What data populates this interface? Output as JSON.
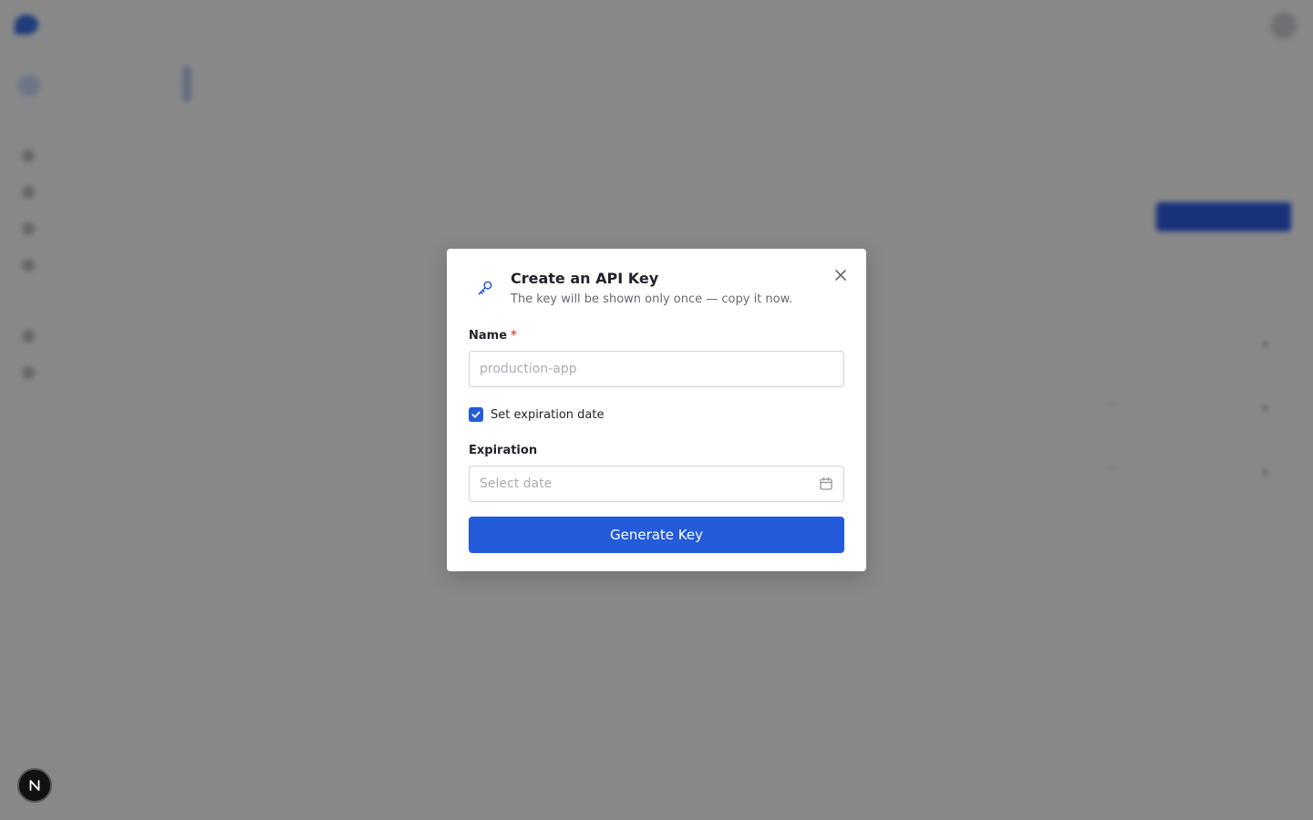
{
  "background": {
    "brand": "",
    "topnav": [
      "",
      "",
      "",
      "",
      ""
    ],
    "workspace": "",
    "sidebar_sections": [
      "",
      ""
    ],
    "sidebar_items_a": [
      "",
      "",
      "",
      ""
    ],
    "sidebar_items_b": [
      "",
      ""
    ],
    "sidebar_footer": [
      "",
      ""
    ],
    "breadcrumb": "",
    "page_title": "",
    "tabs": [
      "",
      "",
      "",
      "",
      ""
    ],
    "section_title": "",
    "section_desc": "",
    "create_button": "",
    "table_headers": [
      "",
      "",
      "",
      "",
      "",
      ""
    ],
    "table_rows": [
      {
        "name": "",
        "key": "",
        "created": "",
        "status": ""
      },
      {
        "name": "",
        "key": "",
        "created": "",
        "status": ""
      },
      {
        "name": "",
        "key": "",
        "created": "",
        "status": ""
      }
    ]
  },
  "modal": {
    "title": "Create an API Key",
    "subtitle": "The key will be shown only once — copy it now.",
    "icon": "key-icon",
    "name_label": "Name",
    "required_mark": "*",
    "name_placeholder": "production-app",
    "name_value": "",
    "expiration_checkbox_label": "Set expiration date",
    "expiration_checked": true,
    "expiration_label": "Expiration",
    "date_placeholder": "Select date",
    "submit_label": "Generate Key"
  },
  "colors": {
    "primary": "#245bdb",
    "required": "#f54a45",
    "overlay": "rgba(0,0,0,0.45)"
  }
}
